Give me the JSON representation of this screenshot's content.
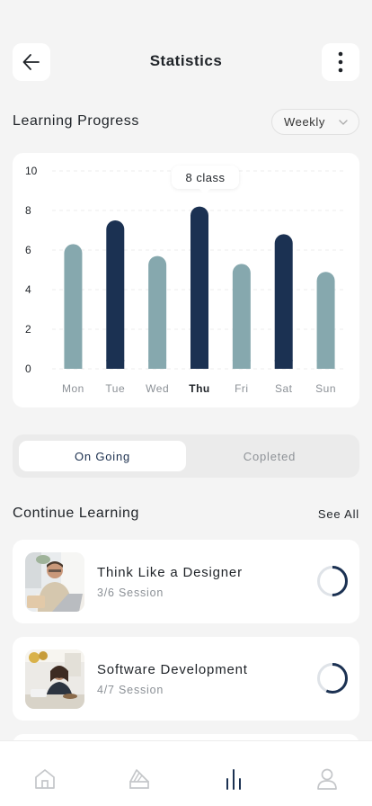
{
  "header": {
    "title": "Statistics",
    "back_icon": "arrow-left-icon",
    "more_icon": "more-vertical-icon"
  },
  "progress": {
    "title": "Learning Progress",
    "period": "Weekly",
    "tooltip": "8 class"
  },
  "chart_data": {
    "type": "bar",
    "categories": [
      "Mon",
      "Tue",
      "Wed",
      "Thu",
      "Fri",
      "Sat",
      "Sun"
    ],
    "values": [
      6.3,
      7.5,
      5.7,
      8.2,
      5.3,
      6.8,
      4.9
    ],
    "highlighted": [
      false,
      true,
      false,
      true,
      false,
      true,
      false
    ],
    "active_category": "Thu",
    "yticks": [
      "0",
      "2",
      "4",
      "6",
      "8",
      "10"
    ],
    "ylim": [
      0,
      10
    ],
    "grid": true,
    "colors": {
      "primary": "#1b3152",
      "muted": "#86a8ae"
    }
  },
  "tabs": {
    "ongoing": "On Going",
    "completed": "Copleted"
  },
  "continue": {
    "title": "Continue Learning",
    "see_all": "See All"
  },
  "courses": [
    {
      "name": "Think Like a Designer",
      "sessions": "3/6 Session",
      "progress": 0.5
    },
    {
      "name": "Software Development",
      "sessions": "4/7 Session",
      "progress": 0.57
    }
  ],
  "nav": {
    "items": [
      "home-icon",
      "design-icon",
      "statistics-icon",
      "profile-icon"
    ],
    "active": "statistics-icon"
  }
}
